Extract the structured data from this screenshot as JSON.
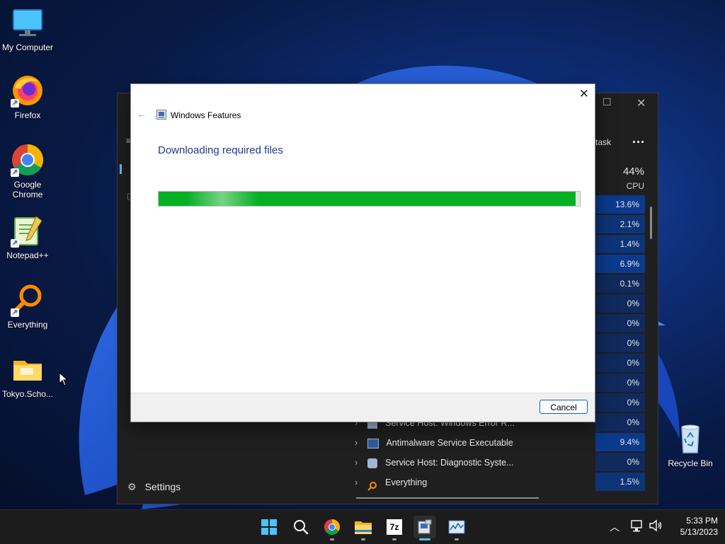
{
  "desktop": {
    "icons": [
      {
        "label": "My Computer",
        "icon": "monitor-icon"
      },
      {
        "label": "Firefox",
        "icon": "firefox-icon"
      },
      {
        "label": "Google Chrome",
        "icon": "chrome-icon"
      },
      {
        "label": "Notepad++",
        "icon": "notepadpp-icon"
      },
      {
        "label": "Everything",
        "icon": "everything-icon"
      },
      {
        "label": "Tokyo.Scho...",
        "icon": "folder-icon"
      }
    ],
    "recycle_bin": {
      "label": "Recycle Bin",
      "icon": "recycle-bin-icon"
    }
  },
  "task_manager": {
    "run_task_label": "task",
    "more_label": "...",
    "cpu_header": {
      "percent": "44%",
      "label": "CPU"
    },
    "cpu_values": [
      "13.6%",
      "2.1%",
      "1.4%",
      "6.9%",
      "0.1%",
      "0%",
      "0%",
      "0%",
      "0%",
      "0%",
      "0%",
      "0%",
      "9.4%",
      "0%",
      "1.5%"
    ],
    "processes": [
      {
        "name": "Service Host: Windows Error R...",
        "icon": "gear-icon"
      },
      {
        "name": "Antimalware Service Executable",
        "icon": "window-icon"
      },
      {
        "name": "Service Host: Diagnostic Syste...",
        "icon": "gear-icon"
      },
      {
        "name": "Everything",
        "icon": "everything-icon"
      }
    ],
    "settings_label": "Settings"
  },
  "dialog": {
    "title": "Windows Features",
    "heading": "Downloading required files",
    "progress_fraction": 0.99,
    "cancel_label": "Cancel"
  },
  "taskbar": {
    "apps": [
      "start-icon",
      "search-icon",
      "chrome-icon",
      "file-explorer-icon",
      "7zip-icon",
      "windows-features-icon",
      "task-manager-icon"
    ],
    "time": "5:33 PM",
    "date": "5/13/2023"
  },
  "colors": {
    "progress": "#06b025",
    "heading": "#1e3a8a",
    "accent": "#0067c0"
  }
}
